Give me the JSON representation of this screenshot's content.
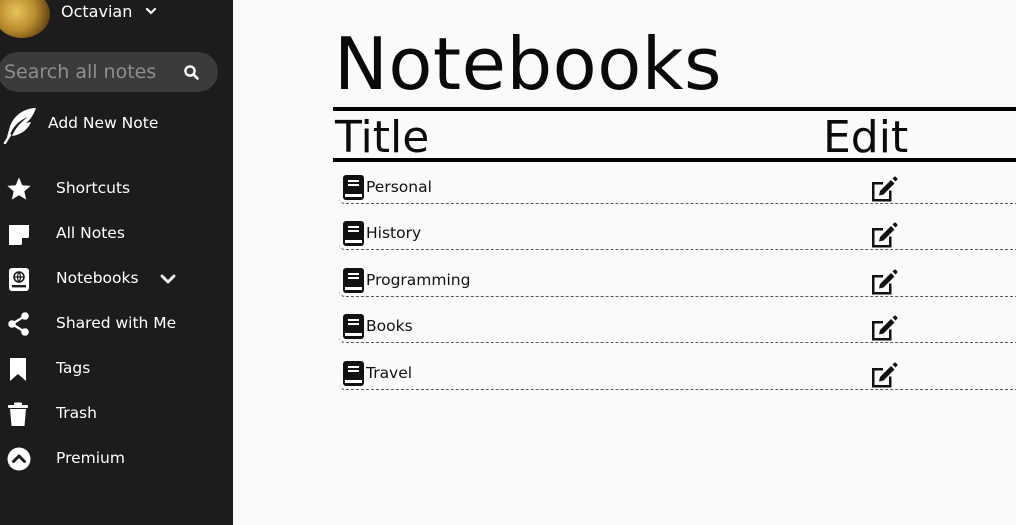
{
  "user": {
    "name": "Octavian"
  },
  "search": {
    "placeholder": "Search all notes"
  },
  "add_note": {
    "label": "Add New Note"
  },
  "sidebar": {
    "items": [
      {
        "label": "Shortcuts",
        "icon": "star-icon"
      },
      {
        "label": "All Notes",
        "icon": "note-icon"
      },
      {
        "label": "Notebooks",
        "icon": "notebook-icon"
      },
      {
        "label": "Shared with Me",
        "icon": "share-icon"
      },
      {
        "label": "Tags",
        "icon": "bookmark-icon"
      },
      {
        "label": "Trash",
        "icon": "trash-icon"
      },
      {
        "label": "Premium",
        "icon": "chevron-up-circle-icon"
      }
    ]
  },
  "main": {
    "title": "Notebooks",
    "columns": {
      "title": "Title",
      "edit": "Edit"
    },
    "rows": [
      {
        "title": "Personal"
      },
      {
        "title": "History"
      },
      {
        "title": "Programming"
      },
      {
        "title": "Books"
      },
      {
        "title": "Travel"
      }
    ]
  },
  "colors": {
    "sidebar_bg": "#1c1c1c",
    "search_bg": "#3b3b3b",
    "main_bg": "#fafafa",
    "text_dark": "#0a0a0a"
  }
}
